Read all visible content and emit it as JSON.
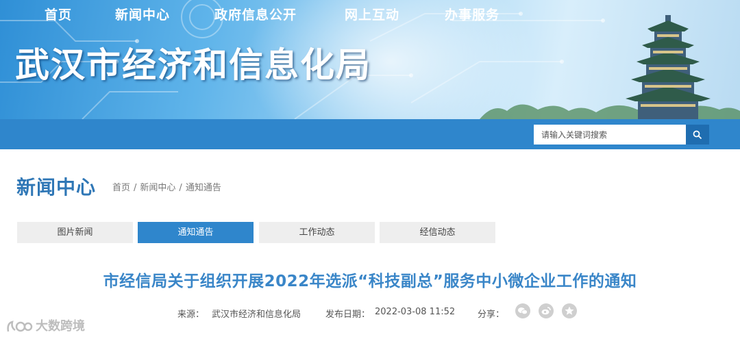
{
  "banner": {
    "title": "武汉市经济和信息化局"
  },
  "nav": {
    "items": [
      {
        "label": "首页"
      },
      {
        "label": "新闻中心"
      },
      {
        "label": "政府信息公开"
      },
      {
        "label": "网上互动"
      },
      {
        "label": "办事服务"
      }
    ],
    "search_placeholder": "请输入关键词搜索"
  },
  "section": {
    "title": "新闻中心",
    "breadcrumb": [
      "首页",
      "新闻中心",
      "通知通告"
    ],
    "breadcrumb_separator": "/"
  },
  "tabs": [
    {
      "label": "图片新闻",
      "active": false
    },
    {
      "label": "通知通告",
      "active": true
    },
    {
      "label": "工作动态",
      "active": false
    },
    {
      "label": "经信动态",
      "active": false
    }
  ],
  "article": {
    "title": "市经信局关于组织开展2022年选派“科技副总”服务中小微企业工作的通知",
    "source_label": "来源：",
    "source_value": "武汉市经济和信息化局",
    "date_label": "发布日期：",
    "date_value": "2022-03-08 11:52",
    "share_label": "分享："
  },
  "share_icons": [
    "wechat-icon",
    "weibo-icon",
    "favorite-icon"
  ],
  "watermark": {
    "text": "大数跨境"
  },
  "colors": {
    "nav": "#2f86cc",
    "accent": "#2f77b6",
    "title": "#3a86c8",
    "tab_inactive": "#eeeeee"
  }
}
